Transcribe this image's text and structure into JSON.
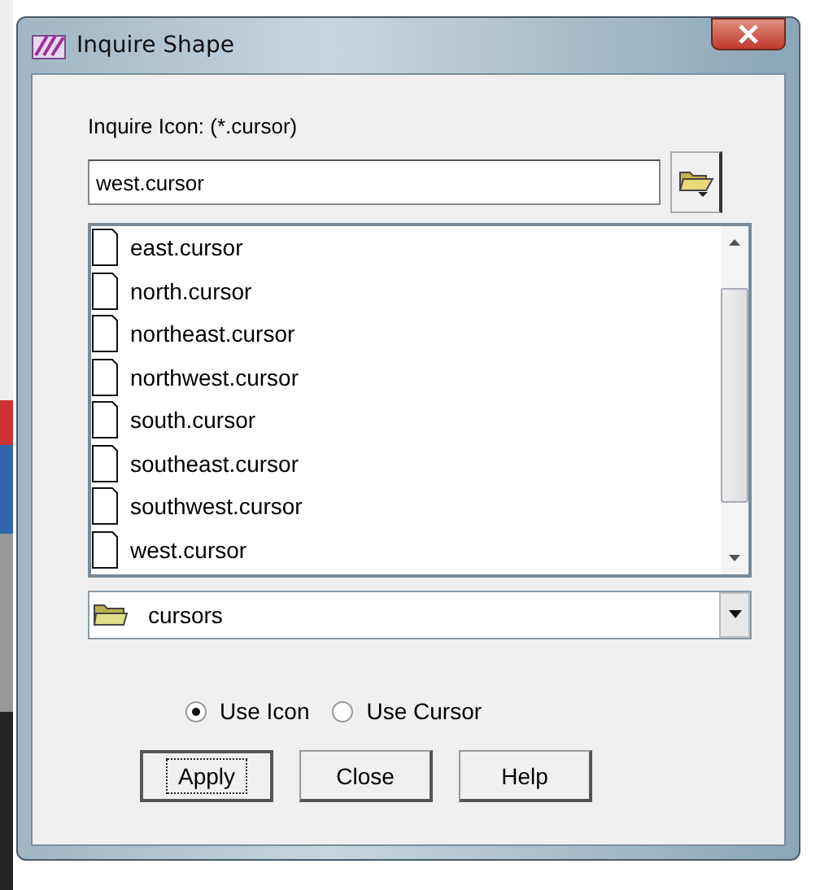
{
  "window": {
    "title": "Inquire Shape"
  },
  "label": "Inquire Icon: (*.cursor)",
  "filename": {
    "value": "west.cursor"
  },
  "files": [
    {
      "name": "east.cursor"
    },
    {
      "name": "north.cursor"
    },
    {
      "name": "northeast.cursor"
    },
    {
      "name": "northwest.cursor"
    },
    {
      "name": "south.cursor"
    },
    {
      "name": "southeast.cursor"
    },
    {
      "name": "southwest.cursor"
    },
    {
      "name": "west.cursor"
    }
  ],
  "folder": {
    "value": "cursors"
  },
  "options": [
    {
      "label": "Use Icon",
      "selected": true
    },
    {
      "label": "Use Cursor",
      "selected": false
    }
  ],
  "buttons": [
    {
      "label": "Apply",
      "focused": true
    },
    {
      "label": "Close",
      "focused": false
    },
    {
      "label": "Help",
      "focused": false
    }
  ]
}
